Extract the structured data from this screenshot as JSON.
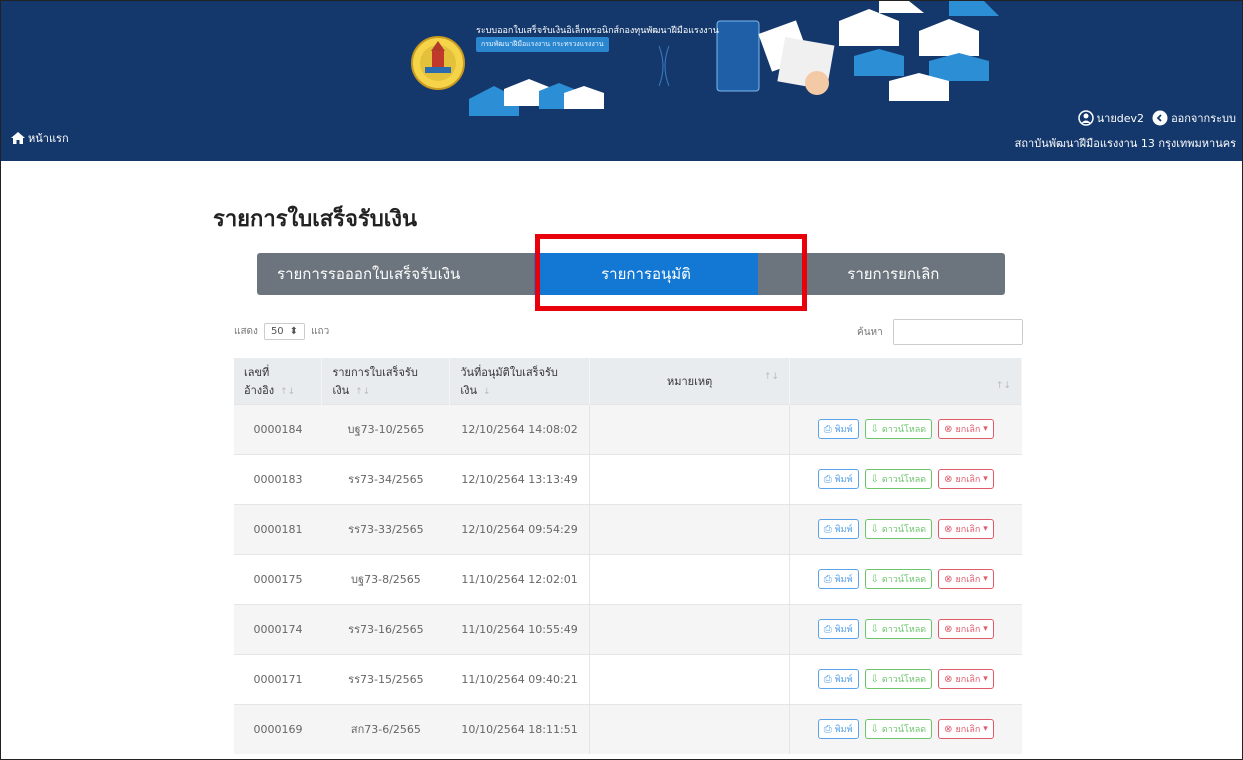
{
  "header": {
    "home_label": "หน้าแรก",
    "banner_title": "ระบบออกใบเสร็จรับเงินอิเล็กทรอนิกส์กองทุนพัฒนาฝีมือแรงงาน",
    "banner_sub": "กรมพัฒนาฝีมือแรงงาน กระทรวงแรงงาน",
    "user_name": "นายdev2",
    "logout_label": "ออกจากระบบ",
    "org_name": "สถาบันพัฒนาฝีมือแรงงาน 13 กรุงเทพมหานคร"
  },
  "page": {
    "title": "รายการใบเสร็จรับเงิน",
    "tabs": [
      {
        "label": "รายการรอออกใบเสร็จรับเงิน",
        "active": false
      },
      {
        "label": "รายการอนุมัติ",
        "active": true
      },
      {
        "label": "รายการยกเลิก",
        "active": false
      }
    ],
    "show_label": "แสดง",
    "page_length": "50",
    "rows_label": "แถว",
    "search_label": "ค้นหา",
    "search_placeholder": ""
  },
  "table": {
    "columns": [
      "เลขที่อ้างอิง",
      "รายการใบเสร็จรับเงิน",
      "วันที่อนุมัติใบเสร็จรับเงิน",
      "หมายเหตุ",
      ""
    ],
    "actions": {
      "print": "พิมพ์",
      "download": "ดาวน์โหลด",
      "cancel": "ยกเลิก"
    },
    "rows": [
      {
        "ref": "0000184",
        "receipt": "บฐ73-10/2565",
        "date": "12/10/2564 14:08:02",
        "note": ""
      },
      {
        "ref": "0000183",
        "receipt": "รร73-34/2565",
        "date": "12/10/2564 13:13:49",
        "note": ""
      },
      {
        "ref": "0000181",
        "receipt": "รร73-33/2565",
        "date": "12/10/2564 09:54:29",
        "note": ""
      },
      {
        "ref": "0000175",
        "receipt": "บฐ73-8/2565",
        "date": "11/10/2564 12:02:01",
        "note": ""
      },
      {
        "ref": "0000174",
        "receipt": "รร73-16/2565",
        "date": "11/10/2564 10:55:49",
        "note": ""
      },
      {
        "ref": "0000171",
        "receipt": "รร73-15/2565",
        "date": "11/10/2564 09:40:21",
        "note": ""
      },
      {
        "ref": "0000169",
        "receipt": "สก73-6/2565",
        "date": "10/10/2564 18:11:51",
        "note": ""
      }
    ]
  },
  "colors": {
    "header_bg": "#14386b",
    "tab_bg": "#6c757d",
    "tab_active": "#1378d4",
    "highlight": "#e8000b"
  }
}
